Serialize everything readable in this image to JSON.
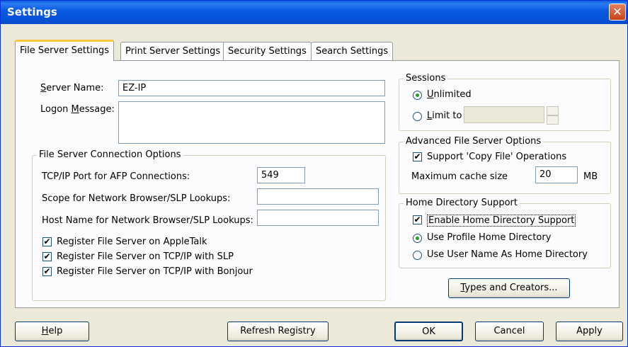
{
  "window": {
    "title": "Settings",
    "close_glyph": "✕"
  },
  "tabs": [
    {
      "label": "File Server Settings"
    },
    {
      "label": "Print Server Settings"
    },
    {
      "label": "Security Settings"
    },
    {
      "label": "Search Settings"
    }
  ],
  "server": {
    "name_label_pre": "",
    "name_label_ul": "S",
    "name_label_post": "erver Name:",
    "name_value": "EZ-IP",
    "logon_label_pre": "Logon ",
    "logon_label_ul": "M",
    "logon_label_post": "essage:",
    "logon_value": ""
  },
  "connection": {
    "group_title": "File Server Connection Options",
    "tcp_label": "TCP/IP Port for AFP Connections:",
    "tcp_value": "549",
    "scope_label": "Scope for Network Browser/SLP Lookups:",
    "scope_value": "",
    "host_label": "Host Name for Network Browser/SLP Lookups:",
    "host_value": "",
    "checks": [
      {
        "label": "Register File Server on AppleTalk",
        "checked": true
      },
      {
        "label": "Register File Server on TCP/IP with SLP",
        "checked": true
      },
      {
        "label": "Register File Server on TCP/IP with Bonjour",
        "checked": true
      }
    ]
  },
  "sessions": {
    "group_title": "Sessions",
    "unlimited_ul": "U",
    "unlimited_rest": "nlimited",
    "limit_ul": "L",
    "limit_rest": "imit to",
    "limit_value": "",
    "selected": "unlimited"
  },
  "advanced": {
    "group_title": "Advanced File Server Options",
    "copy_label": "Support 'Copy File' Operations",
    "copy_checked": true,
    "cache_label": "Maximum cache size",
    "cache_value": "20",
    "cache_unit": "MB"
  },
  "home": {
    "group_title": "Home Directory Support",
    "enable_label": "Enable Home Directory Support",
    "enable_checked": true,
    "profile_label": "Use Profile Home Directory",
    "username_label": "Use User Name As Home Directory",
    "selected": "profile"
  },
  "buttons": {
    "types_ul": "T",
    "types_rest": "ypes and Creators...",
    "help_ul": "H",
    "help_rest": "elp",
    "refresh": "Refresh Registry",
    "ok": "OK",
    "cancel": "Cancel",
    "apply": "Apply"
  },
  "icons": {
    "check": "✔",
    "spin_up": "▴",
    "spin_down": "▾"
  }
}
